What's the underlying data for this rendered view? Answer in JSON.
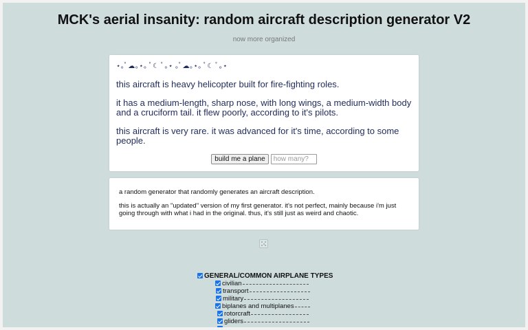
{
  "header": {
    "title": "MCK's aerial insanity: random aircraft description generator V2",
    "subtitle": "now more organized"
  },
  "generator": {
    "decoration": "⋆｡ﾟ☁︎｡⋆｡ ﾟ☾ ﾟ｡⋆ ｡ﾟ☁︎｡⋆｡ ﾟ☾ ﾟ｡⋆",
    "paragraphs": [
      "this aircraft is heavy helicopter built for fire-fighting roles.",
      "it has a medium-length, sharp nose, with long wings, a medium-width body and a cruciform tail. it flew poorly, according to it's pilots.",
      "this aircraft is very rare. it was advanced for it's time, according to some people."
    ],
    "build_button_label": "build me a plane",
    "count_placeholder": "how many?"
  },
  "info": {
    "paragraphs": [
      "a random generator that randomly generates an aircraft description.",
      "this is actually an \"updated\" version of my first generator. it's not perfect, mainly because i'm just going through with what i had in the original. thus, it's still just as weird and chaotic."
    ]
  },
  "icons": {
    "dice": "dice-icon"
  },
  "categories": {
    "group_label": "GENERAL/COMMON AIRPLANE TYPES",
    "group_checked": true,
    "items": [
      {
        "label": "civilian",
        "checked": true
      },
      {
        "label": "transport",
        "checked": true
      },
      {
        "label": "military",
        "checked": true
      },
      {
        "label": "biplanes and multiplanes",
        "checked": true
      },
      {
        "label": "rotorcraft",
        "checked": true
      },
      {
        "label": "gliders",
        "checked": true
      }
    ]
  },
  "colors": {
    "background": "#cfdcdc",
    "text_accent": "#1f2b5a",
    "checkbox": "#1a73e8"
  }
}
